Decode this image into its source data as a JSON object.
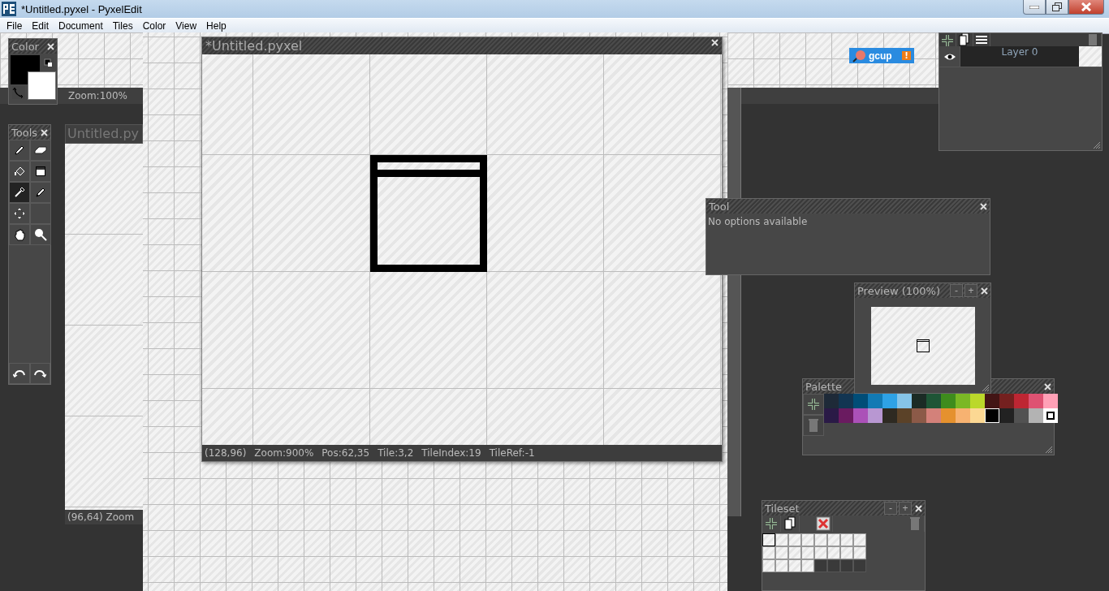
{
  "window": {
    "title": "*Untitled.pyxel - PyxelEdit"
  },
  "menu": [
    "File",
    "Edit",
    "Document",
    "Tiles",
    "Color",
    "View",
    "Help"
  ],
  "back_document": {
    "status": "Zoom:100%"
  },
  "side_document": {
    "title": "Untitled.py",
    "status": "(96,64)  Zoom"
  },
  "document": {
    "title": "*Untitled.pyxel",
    "status": [
      "(128,96)",
      "Zoom:900%",
      "Pos:62,35",
      "Tile:3,2",
      "TileIndex:19",
      "TileRef:-1"
    ]
  },
  "color_panel": {
    "title": "Color",
    "swatches": [
      {
        "kind": "primary",
        "color": "#000000"
      },
      {
        "kind": "secondary",
        "color": "#ffffff"
      }
    ]
  },
  "tools_panel": {
    "title": "Tools",
    "tools": [
      {
        "kind": "pencil",
        "selected": false
      },
      {
        "kind": "eraser",
        "selected": false
      },
      {
        "kind": "fill",
        "selected": false
      },
      {
        "kind": "select",
        "selected": false
      },
      {
        "kind": "eyedropper",
        "selected": true
      },
      {
        "kind": "pen",
        "selected": false
      },
      {
        "kind": "move",
        "selected": false
      },
      {
        "kind": "hand",
        "selected": false
      },
      {
        "kind": "zoom",
        "selected": false
      }
    ],
    "history": [
      {
        "kind": "undo"
      },
      {
        "kind": "redo"
      }
    ]
  },
  "notification": {
    "label": "gcup",
    "badge": "!"
  },
  "layers_panel": {
    "layers": [
      {
        "name": "Layer 0",
        "visible": true
      }
    ]
  },
  "tool_panel": {
    "title": "Tool",
    "message": "No options available"
  },
  "preview_panel": {
    "title": "Preview (100%)",
    "zoom_out": "-",
    "zoom_in": "+"
  },
  "palette_panel": {
    "title": "Palette",
    "colors": [
      {
        "color": "#1e2a38",
        "selected": false
      },
      {
        "color": "#123552",
        "selected": false
      },
      {
        "color": "#004d77",
        "selected": false
      },
      {
        "color": "#127ab4",
        "selected": false
      },
      {
        "color": "#2ea2e6",
        "selected": false
      },
      {
        "color": "#86c4e8",
        "selected": false
      },
      {
        "color": "#1b2b25",
        "selected": false
      },
      {
        "color": "#1e5536",
        "selected": false
      },
      {
        "color": "#3e8c1d",
        "selected": false
      },
      {
        "color": "#7ab825",
        "selected": false
      },
      {
        "color": "#bbd82a",
        "selected": false
      },
      {
        "color": "#431515",
        "selected": false
      },
      {
        "color": "#74201f",
        "selected": false
      },
      {
        "color": "#be2633",
        "selected": false
      },
      {
        "color": "#de5272",
        "selected": false
      },
      {
        "color": "#ffa0b6",
        "selected": false
      },
      {
        "color": "#2a1a46",
        "selected": false
      },
      {
        "color": "#6a1b60",
        "selected": false
      },
      {
        "color": "#ab51b8",
        "selected": false
      },
      {
        "color": "#b897d2",
        "selected": false
      },
      {
        "color": "#2e2a22",
        "selected": false
      },
      {
        "color": "#5b4228",
        "selected": false
      },
      {
        "color": "#8c5a48",
        "selected": false
      },
      {
        "color": "#d3817a",
        "selected": false
      },
      {
        "color": "#e5912e",
        "selected": false
      },
      {
        "color": "#f7b271",
        "selected": false
      },
      {
        "color": "#fcd893",
        "selected": false
      },
      {
        "color": "#000000",
        "selected": true
      },
      {
        "color": "#222222",
        "selected": false
      },
      {
        "color": "#525252",
        "selected": false
      },
      {
        "color": "#b3b3b3",
        "selected": false
      },
      {
        "color": "#ffffff",
        "selected": false,
        "secondary": true
      }
    ]
  },
  "tileset_panel": {
    "title": "Tileset",
    "zoom_out": "-",
    "zoom_in": "+",
    "tiles": [
      {
        "kind": "tile",
        "selected": true
      },
      {
        "kind": "tile",
        "selected": false
      },
      {
        "kind": "tile",
        "selected": false
      },
      {
        "kind": "tile",
        "selected": false
      },
      {
        "kind": "tile",
        "selected": false
      },
      {
        "kind": "tile",
        "selected": false
      },
      {
        "kind": "tile",
        "selected": false
      },
      {
        "kind": "tile",
        "selected": false
      },
      {
        "kind": "tile",
        "selected": false
      },
      {
        "kind": "tile",
        "selected": false
      },
      {
        "kind": "tile",
        "selected": false
      },
      {
        "kind": "tile",
        "selected": false
      },
      {
        "kind": "tile",
        "selected": false
      },
      {
        "kind": "tile",
        "selected": false
      },
      {
        "kind": "tile",
        "selected": false
      },
      {
        "kind": "tile",
        "selected": false
      },
      {
        "kind": "tile",
        "selected": false
      },
      {
        "kind": "tile",
        "selected": false
      },
      {
        "kind": "tile",
        "selected": false
      },
      {
        "kind": "tile",
        "selected": false
      },
      {
        "kind": "empty",
        "selected": false
      },
      {
        "kind": "empty",
        "selected": false
      },
      {
        "kind": "empty",
        "selected": false
      },
      {
        "kind": "empty",
        "selected": false
      }
    ]
  }
}
